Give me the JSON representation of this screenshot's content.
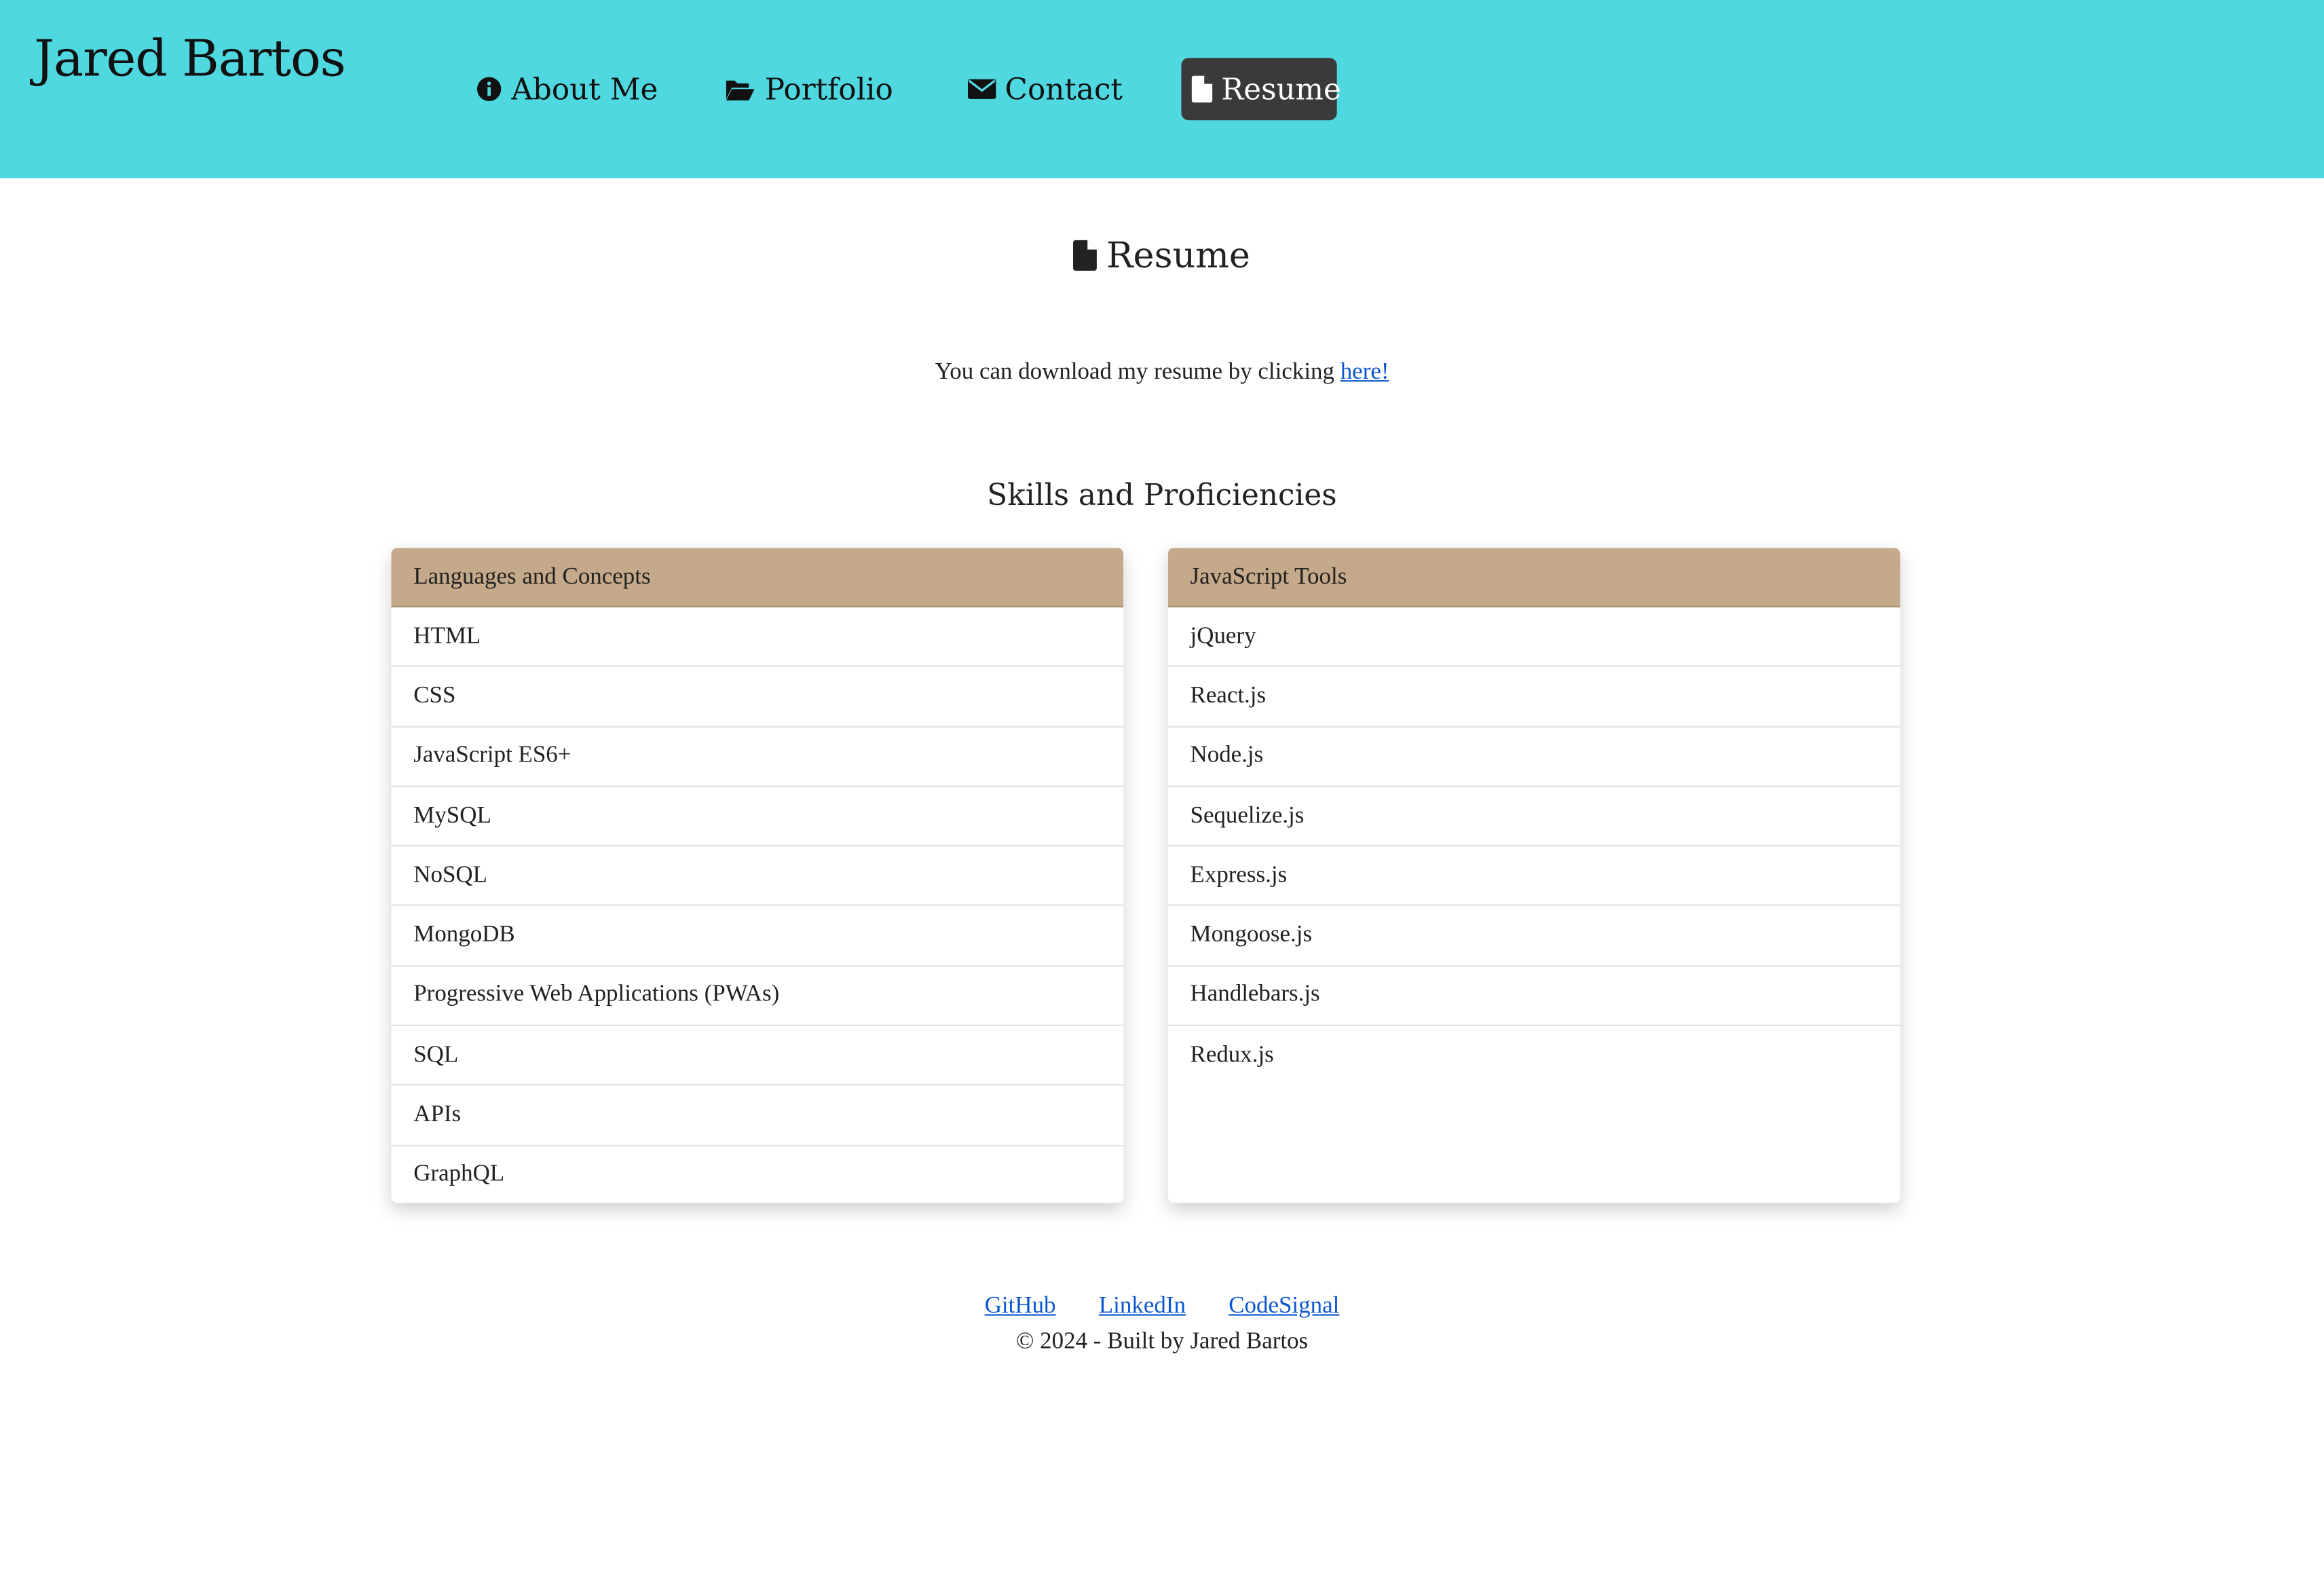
{
  "site": {
    "brand": "Jared Bartos"
  },
  "nav": {
    "items": [
      {
        "label": "About Me",
        "icon": "info-circle-icon"
      },
      {
        "label": "Portfolio",
        "icon": "folder-open-icon"
      },
      {
        "label": "Contact",
        "icon": "envelope-icon"
      },
      {
        "label": "Resume",
        "icon": "file-icon",
        "active": true
      }
    ]
  },
  "page": {
    "title": "Resume",
    "intro_text": "You can download my resume by clicking",
    "intro_link": "here!",
    "skills_title": "Skills and Proficiencies"
  },
  "cards": [
    {
      "header": "Languages and Concepts",
      "items": [
        "HTML",
        "CSS",
        "JavaScript ES6+",
        "MySQL",
        "NoSQL",
        "MongoDB",
        "Progressive Web Applications (PWAs)",
        "SQL",
        "APIs",
        "GraphQL"
      ]
    },
    {
      "header": "JavaScript Tools",
      "items": [
        "jQuery",
        "React.js",
        "Node.js",
        "Sequelize.js",
        "Express.js",
        "Mongoose.js",
        "Handlebars.js",
        "Redux.js"
      ]
    }
  ],
  "footer": {
    "links": [
      "GitHub",
      "LinkedIn",
      "CodeSignal"
    ],
    "copyright": "© 2024 - Built by Jared Bartos"
  },
  "colors": {
    "header_bg": "#4fd8e0",
    "active_nav_bg": "#3a3a3a",
    "card_header_bg": "#c4a98a",
    "link": "#0b57d0"
  }
}
